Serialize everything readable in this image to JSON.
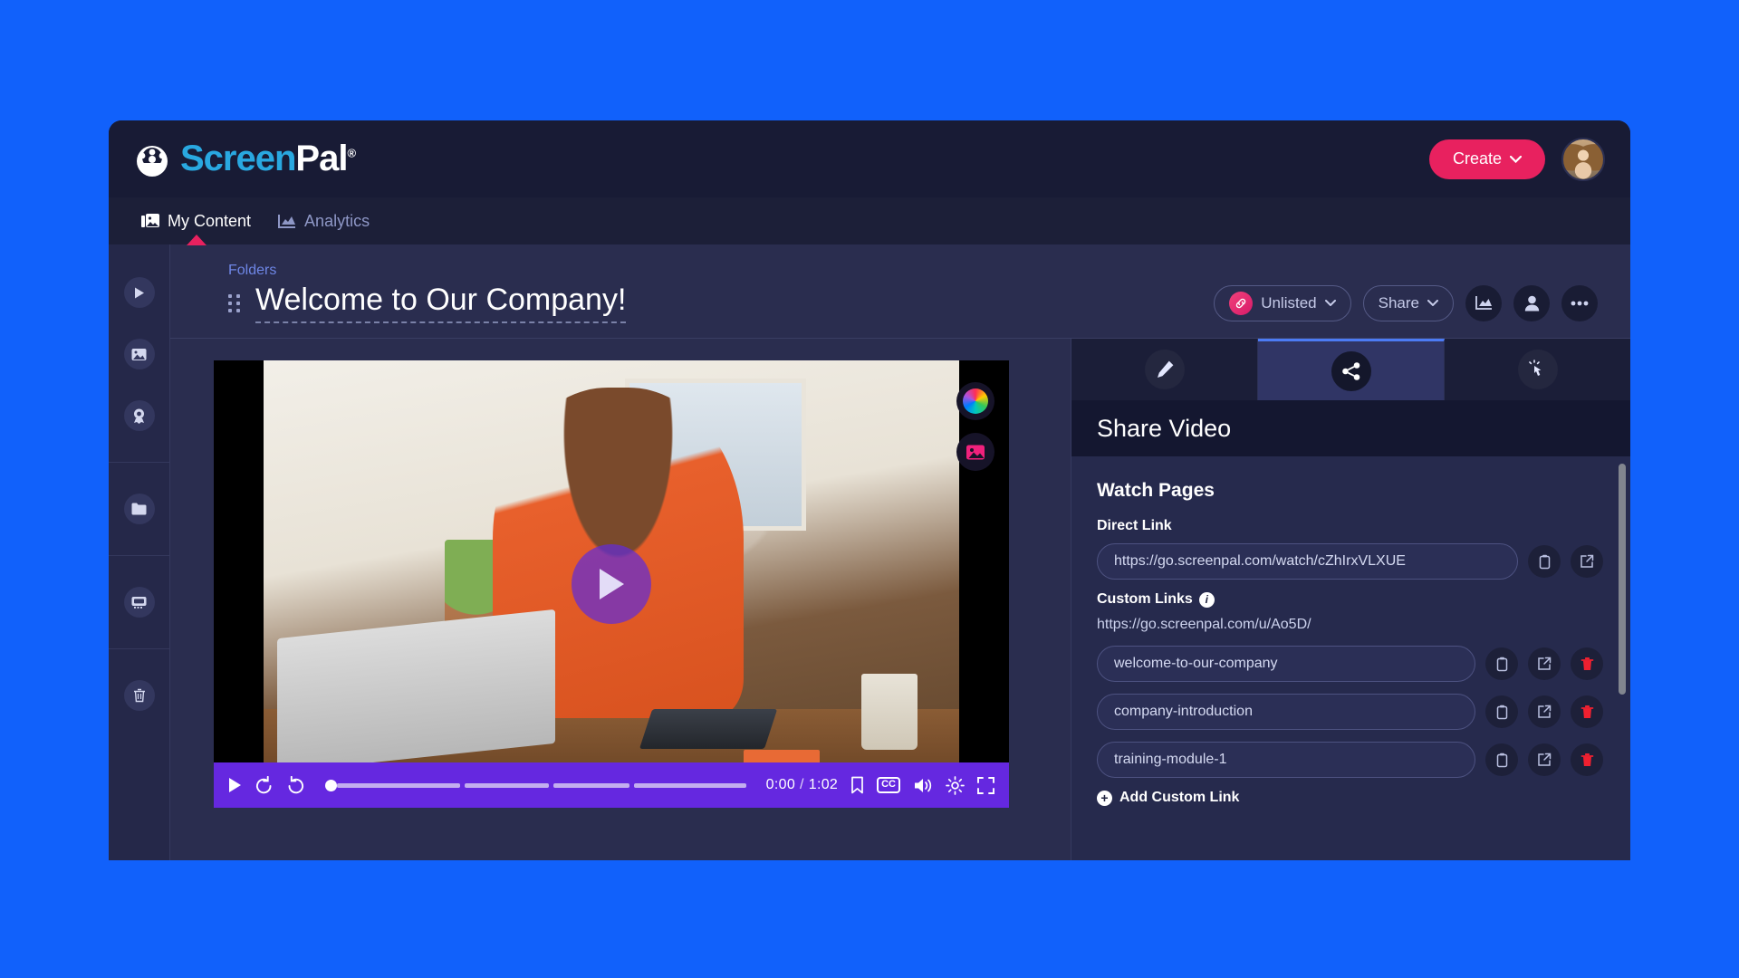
{
  "brand": {
    "name_part1": "Screen",
    "name_part2": "Pal",
    "registered": "®"
  },
  "topbar": {
    "create_label": "Create",
    "create_color": "#e8215f",
    "avatar_name": "user-avatar"
  },
  "nav": {
    "items": [
      {
        "label": "My Content",
        "icon": "content-library-icon",
        "active": true
      },
      {
        "label": "Analytics",
        "icon": "analytics-chart-icon",
        "active": false
      }
    ],
    "active_indicator_color": "#e8215f"
  },
  "sidebar": {
    "items": [
      {
        "icon": "video-play-icon",
        "name": "sidebar-item-videos"
      },
      {
        "icon": "image-icon",
        "name": "sidebar-item-images"
      },
      {
        "icon": "badge-award-icon",
        "name": "sidebar-item-badges"
      },
      {
        "icon": "folder-icon",
        "name": "sidebar-item-folders"
      },
      {
        "icon": "presentation-icon",
        "name": "sidebar-item-presentations"
      },
      {
        "icon": "trash-icon",
        "name": "sidebar-item-trash"
      }
    ]
  },
  "page": {
    "breadcrumb": "Folders",
    "title": "Welcome to Our Company!",
    "visibility": {
      "label": "Unlisted",
      "icon": "link-icon",
      "badge_color": "#e8215f"
    },
    "share_dropdown": "Share",
    "actions": [
      {
        "icon": "analytics-chart-icon",
        "name": "video-analytics-button"
      },
      {
        "icon": "person-icon",
        "name": "video-permissions-button"
      },
      {
        "icon": "more-dots-icon",
        "name": "video-more-options-button"
      }
    ]
  },
  "player": {
    "current_time": "0:00",
    "separator": "/",
    "duration": "1:02",
    "progress_percent": 0,
    "segments": 4,
    "bar_color": "#6528e0",
    "overlay_buttons": [
      {
        "icon": "color-wheel-icon",
        "name": "video-color-theme-button"
      },
      {
        "icon": "thumbnail-image-icon",
        "name": "video-thumbnail-button"
      }
    ],
    "controls": [
      {
        "icon": "play-icon",
        "name": "play-button"
      },
      {
        "icon": "rewind-icon",
        "name": "rewind-button"
      },
      {
        "icon": "forward-icon",
        "name": "forward-button"
      },
      {
        "icon": "bookmark-icon",
        "name": "bookmark-button"
      },
      {
        "icon": "closed-captions-icon",
        "name": "captions-button"
      },
      {
        "icon": "volume-icon",
        "name": "volume-button"
      },
      {
        "icon": "gear-icon",
        "name": "settings-button"
      },
      {
        "icon": "fullscreen-icon",
        "name": "fullscreen-button"
      }
    ],
    "cc_label": "CC"
  },
  "panel": {
    "tabs": [
      {
        "icon": "pencil-edit-icon",
        "name": "tab-edit",
        "active": false
      },
      {
        "icon": "share-nodes-icon",
        "name": "tab-share",
        "active": true
      },
      {
        "icon": "interactive-click-icon",
        "name": "tab-interactivity",
        "active": false
      }
    ],
    "heading": "Share Video",
    "watch_pages_title": "Watch Pages",
    "direct_link_label": "Direct Link",
    "direct_link_value": "https://go.screenpal.com/watch/cZhIrxVLXUE",
    "custom_links_label": "Custom Links",
    "custom_links_base_url": "https://go.screenpal.com/u/Ao5D/",
    "custom_links": [
      {
        "slug": "welcome-to-our-company"
      },
      {
        "slug": "company-introduction"
      },
      {
        "slug": "training-module-1"
      }
    ],
    "add_custom_link_label": "Add Custom Link",
    "row_actions": [
      {
        "icon": "copy-icon",
        "name": "copy-link-button"
      },
      {
        "icon": "open-external-icon",
        "name": "open-link-button"
      },
      {
        "icon": "delete-trash-icon",
        "name": "delete-link-button"
      }
    ]
  }
}
